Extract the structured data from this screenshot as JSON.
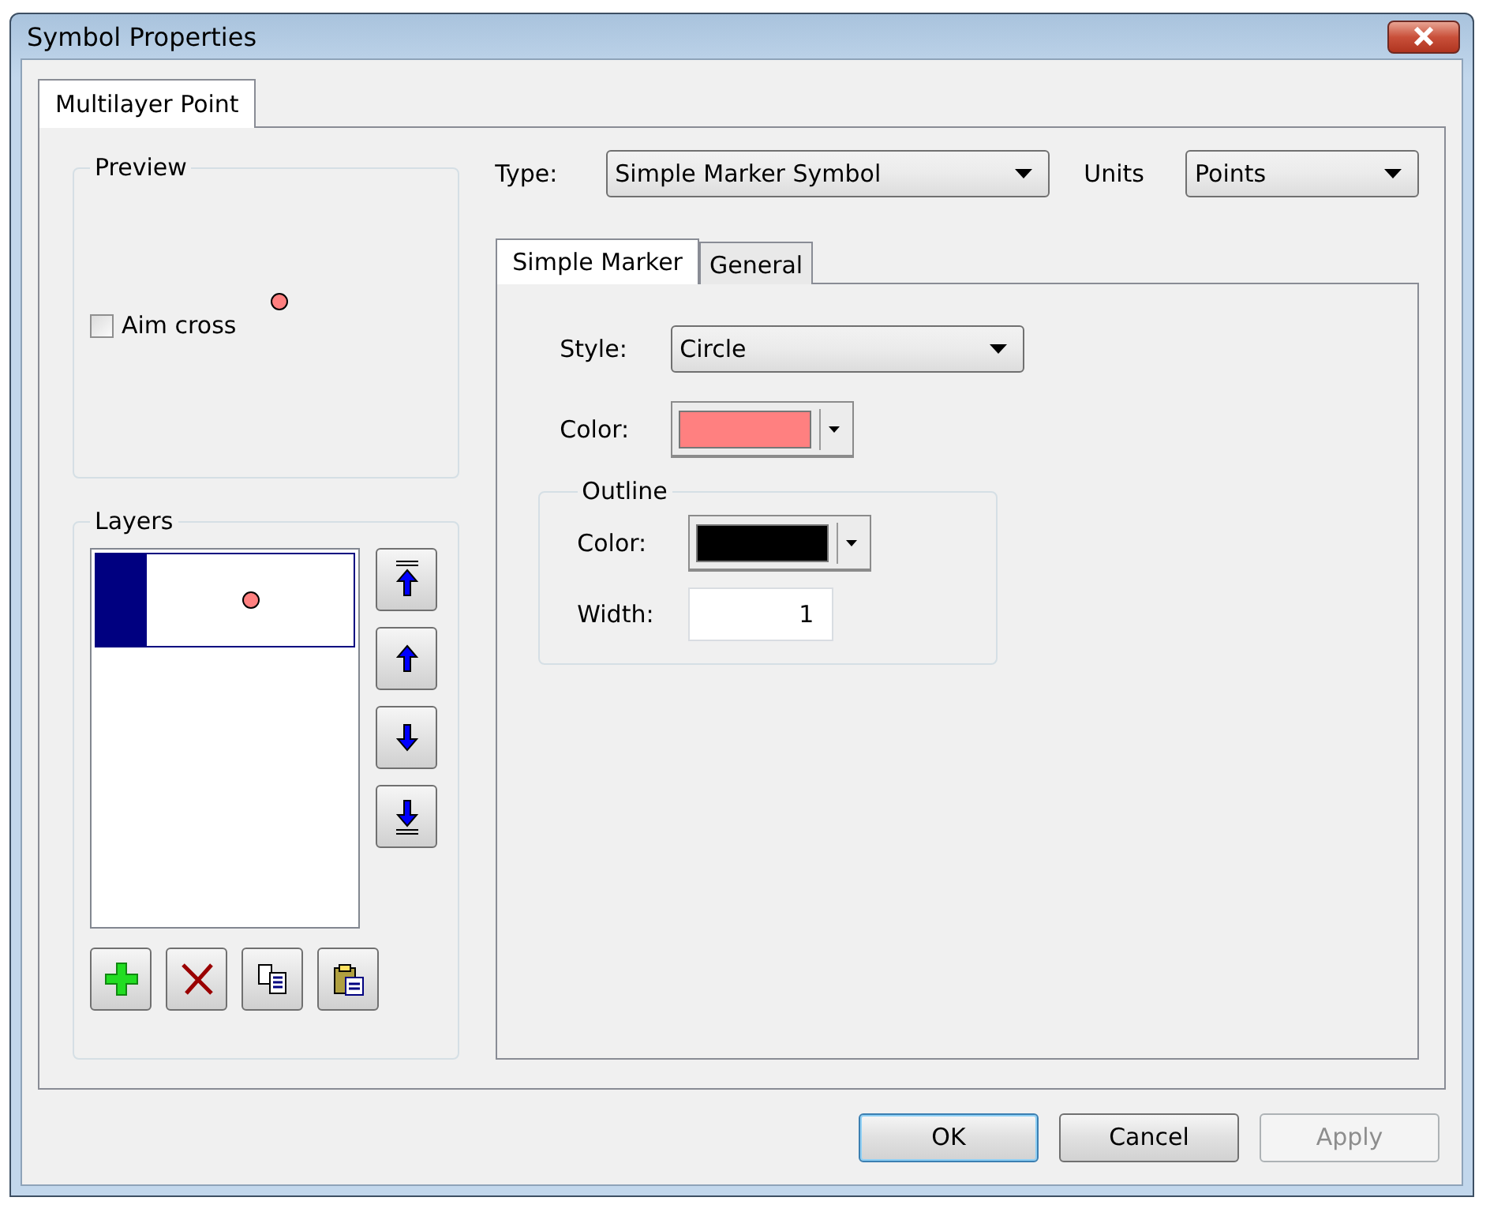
{
  "window": {
    "title": "Symbol Properties"
  },
  "tabs": [
    {
      "label": "Multilayer Point",
      "selected": true
    }
  ],
  "preview": {
    "title": "Preview",
    "aim_cross": {
      "label": "Aim cross",
      "checked": false
    }
  },
  "layers": {
    "title": "Layers",
    "items": [
      {
        "selected": true
      }
    ]
  },
  "type": {
    "label": "Type:",
    "value": "Simple Marker Symbol"
  },
  "units": {
    "label": "Units",
    "value": "Points"
  },
  "inner_tabs": [
    {
      "label": "Simple Marker",
      "selected": true
    },
    {
      "label": "General",
      "selected": false
    }
  ],
  "simple_marker": {
    "style": {
      "label": "Style:",
      "value": "Circle"
    },
    "color": {
      "label": "Color:",
      "color": "#ff8080"
    },
    "outline": {
      "title": "Outline",
      "color": {
        "label": "Color:",
        "color": "#000000"
      },
      "width": {
        "label": "Width:",
        "value": "1"
      }
    }
  },
  "buttons": [
    {
      "label": "OK",
      "default": true,
      "disabled": false
    },
    {
      "label": "Cancel",
      "default": false,
      "disabled": false
    },
    {
      "label": "Apply",
      "default": false,
      "disabled": true
    }
  ]
}
